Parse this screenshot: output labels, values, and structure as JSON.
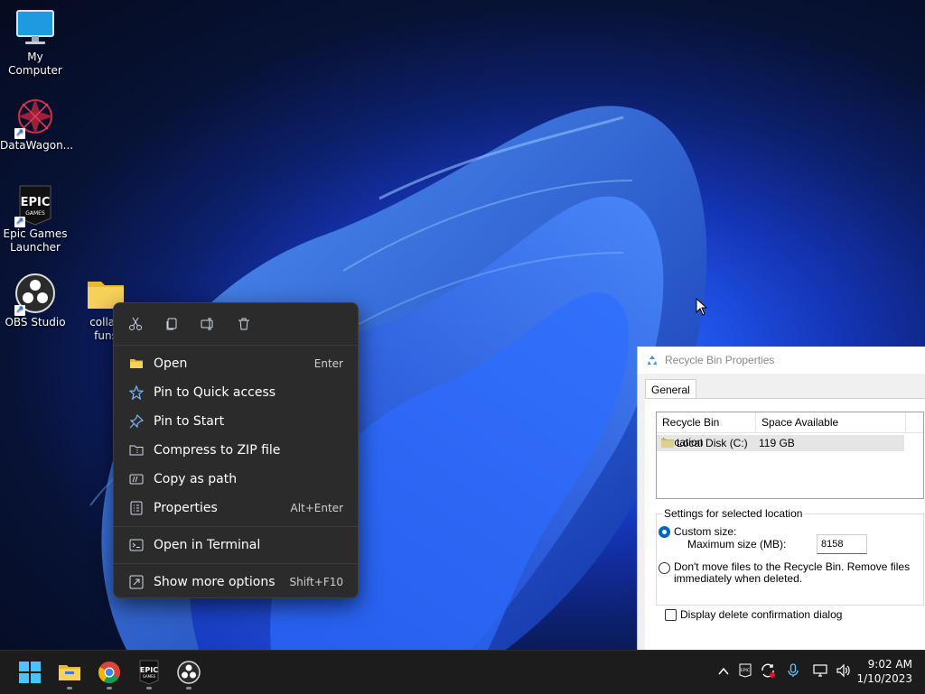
{
  "desktop": {
    "icons": [
      {
        "label": "My Computer"
      },
      {
        "label": "DataWagon..."
      },
      {
        "label": "Epic Games Launcher"
      },
      {
        "label": "OBS Studio"
      },
      {
        "label": "collab funs",
        "label_line1": "collab",
        "label_line2": "funs"
      }
    ]
  },
  "context_menu": {
    "toolbar": [
      "cut-icon",
      "copy-icon",
      "rename-icon",
      "delete-icon"
    ],
    "items": [
      {
        "label": "Open",
        "shortcut": "Enter",
        "icon": "folder-icon"
      },
      {
        "label": "Pin to Quick access",
        "shortcut": "",
        "icon": "star-icon"
      },
      {
        "label": "Pin to Start",
        "shortcut": "",
        "icon": "pin-icon"
      },
      {
        "label": "Compress to ZIP file",
        "shortcut": "",
        "icon": "zip-icon"
      },
      {
        "label": "Copy as path",
        "shortcut": "",
        "icon": "path-icon"
      },
      {
        "label": "Properties",
        "shortcut": "Alt+Enter",
        "icon": "properties-icon"
      },
      {
        "label": "Open in Terminal",
        "shortcut": "",
        "icon": "terminal-icon"
      },
      {
        "label": "Show more options",
        "shortcut": "Shift+F10",
        "icon": "more-options-icon"
      }
    ]
  },
  "recycle_dialog": {
    "title": "Recycle Bin Properties",
    "tab": "General",
    "columns": [
      "Recycle Bin Location",
      "Space Available"
    ],
    "rows": [
      {
        "location": "Local Disk (C:)",
        "space": "119 GB"
      }
    ],
    "settings_title": "Settings for selected location",
    "custom_size_label": "Custom size:",
    "max_size_label": "Maximum size (MB):",
    "max_size_value": "8158",
    "dont_move_label_line1": "Don't move files to the Recycle Bin. Remove files",
    "dont_move_label_line2": "immediately when deleted.",
    "confirm_label": "Display delete confirmation dialog"
  },
  "taskbar": {
    "apps": [
      "start-button",
      "file-explorer",
      "chrome",
      "epic-games",
      "obs-studio"
    ],
    "tray_icons": [
      "chevron-up-icon",
      "epic-tray-icon",
      "sync-icon",
      "microphone-icon",
      "network-icon",
      "volume-icon"
    ],
    "time": "9:02 AM",
    "date": "1/10/2023"
  },
  "colors": {
    "accent": "#0067c0",
    "menu_bg": "#2b2b2b",
    "taskbar_bg": "#1c1c1c",
    "folder_yellow": "#f2c744"
  }
}
